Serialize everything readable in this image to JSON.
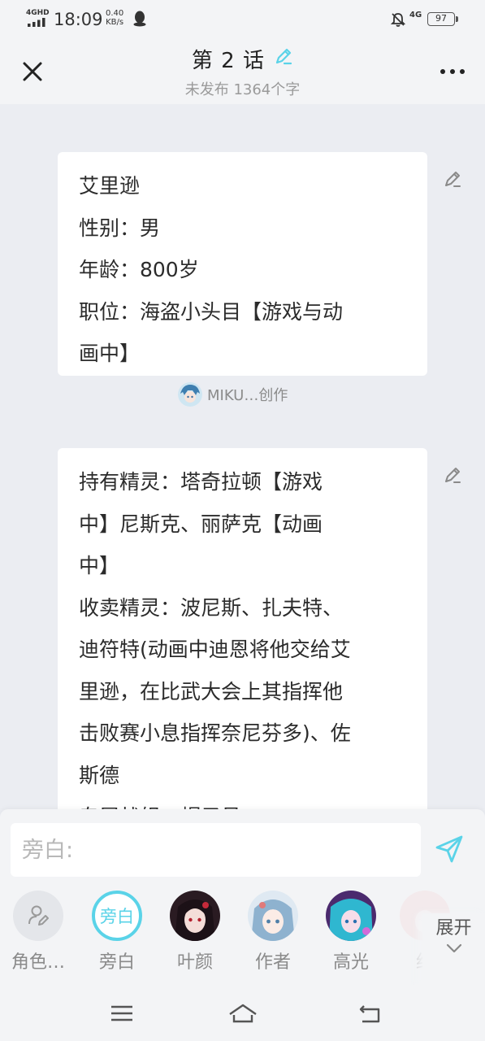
{
  "status_bar": {
    "network": "4GHD",
    "time": "18:09",
    "speed_value": "0.40",
    "speed_unit": "KB/s",
    "mobile": "4G",
    "battery": "97"
  },
  "header": {
    "title": "第 2 话",
    "subtitle": "未发布 1364个字"
  },
  "cards": [
    {
      "lines": [
        "艾里逊",
        "性别：男",
        "年龄：800岁",
        "职位：海盗小头目【游戏与动",
        "画中】"
      ],
      "author": "MIKU…创作"
    },
    {
      "lines": [
        "持有精灵：塔奇拉顿【游戏",
        "中】尼斯克、丽萨克【动画",
        "中】",
        "收卖精灵：波尼斯、扎夫特、",
        "迪符特(动画中迪恩将他交给艾",
        "里逊，在比武大会上其指挥他",
        "击败赛小息指挥奈尼芬多)、佐",
        "斯德",
        "专属战舰：帽子号"
      ]
    }
  ],
  "input": {
    "placeholder": "旁白:"
  },
  "roles": [
    {
      "label": "角色…",
      "icon": "character-edit-icon"
    },
    {
      "label": "旁白",
      "badge": "旁白"
    },
    {
      "label": "叶颜"
    },
    {
      "label": "作者"
    },
    {
      "label": "高光"
    },
    {
      "label": "红"
    }
  ],
  "expand_label": "展开",
  "colors": {
    "accent": "#5ad3e8",
    "background": "#ebedf2",
    "card": "#ffffff"
  }
}
